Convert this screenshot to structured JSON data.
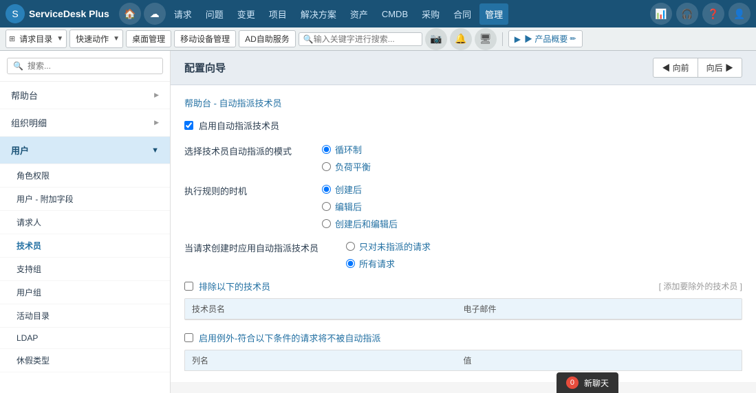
{
  "brand": {
    "name": "ServiceDesk Plus",
    "plus_symbol": "+"
  },
  "nav": {
    "home_icon": "🏠",
    "cloud_icon": "☁",
    "items": [
      {
        "label": "请求",
        "active": false
      },
      {
        "label": "问题",
        "active": false
      },
      {
        "label": "变更",
        "active": false
      },
      {
        "label": "项目",
        "active": false
      },
      {
        "label": "解决方案",
        "active": false
      },
      {
        "label": "资产",
        "active": false
      },
      {
        "label": "CMDB",
        "active": false
      },
      {
        "label": "采购",
        "active": false
      },
      {
        "label": "合同",
        "active": false
      },
      {
        "label": "管理",
        "active": true
      }
    ],
    "right_icons": [
      "📊",
      "🎧",
      "❓",
      "👤"
    ]
  },
  "toolbar": {
    "request_menu": "请求目录",
    "quick_action": "快速动作",
    "desktop_mgmt": "桌面管理",
    "mobile_mgmt": "移动设备管理",
    "ad_service": "AD自助服务",
    "search_placeholder": "输入关键字进行搜索...",
    "product_overview": "▶ 产品概要"
  },
  "sidebar": {
    "search_placeholder": "搜索...",
    "items": [
      {
        "label": "帮助台",
        "type": "arrow"
      },
      {
        "label": "组织明细",
        "type": "arrow"
      },
      {
        "label": "用户",
        "type": "expanded"
      },
      {
        "label": "角色权限",
        "type": "sub"
      },
      {
        "label": "用户 - 附加字段",
        "type": "sub"
      },
      {
        "label": "请求人",
        "type": "sub"
      },
      {
        "label": "技术员",
        "type": "sub",
        "active": true
      },
      {
        "label": "支持组",
        "type": "sub"
      },
      {
        "label": "用户组",
        "type": "sub"
      },
      {
        "label": "活动目录",
        "type": "sub"
      },
      {
        "label": "LDAP",
        "type": "sub"
      },
      {
        "label": "休假类型",
        "type": "sub"
      }
    ]
  },
  "content": {
    "header_title": "配置向导",
    "nav_prev": "◀ 向前",
    "nav_next": "向后 ▶",
    "breadcrumb": "帮助台 - 自动指派技术员",
    "enable_auto_assign": "启用自动指派技术员",
    "mode_label": "选择技术员自动指派的模式",
    "modes": [
      {
        "label": "循环制",
        "selected": true
      },
      {
        "label": "负荷平衡",
        "selected": false
      }
    ],
    "timing_label": "执行规则的时机",
    "timings": [
      {
        "label": "创建后",
        "selected": true
      },
      {
        "label": "编辑后",
        "selected": false
      },
      {
        "label": "创建后和编辑后",
        "selected": false
      }
    ],
    "apply_label": "当请求创建时应用自动指派技术员",
    "apply_options": [
      {
        "label": "只对未指派的请求",
        "selected": false
      },
      {
        "label": "所有请求",
        "selected": true
      }
    ],
    "exclude_title": "排除以下的技术员",
    "add_exclude_link": "[ 添加要除外的技术员 ]",
    "table_columns": [
      {
        "label": "技术员名"
      },
      {
        "label": "电子邮件"
      }
    ],
    "exception_title": "启用例外-符合以下条件的请求将不被自动指派",
    "column_headers": [
      {
        "label": "列名"
      },
      {
        "label": "值"
      }
    ]
  },
  "chat": {
    "label": "新聊天",
    "count": "0"
  },
  "colors": {
    "nav_bg": "#1a3a5c",
    "active_nav": "#2471a3",
    "link_color": "#2471a3"
  }
}
